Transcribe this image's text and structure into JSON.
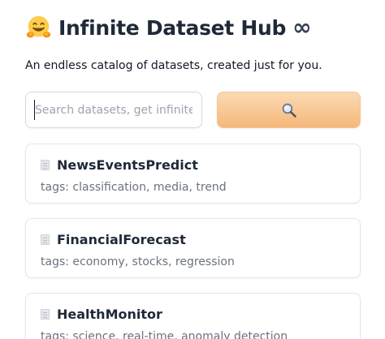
{
  "header": {
    "emoji_icon": "hugging-face-emoji",
    "title": "Infinite Dataset Hub",
    "infinity_symbol": "∞"
  },
  "subtitle": "An endless catalog of datasets, created just for you.",
  "search": {
    "placeholder": "Search datasets, get infinite results",
    "value": "",
    "button_icon": "magnifier-icon",
    "button_color": "#f6b87a"
  },
  "datasets": [
    {
      "icon": "document-icon",
      "name": "NewsEventsPredict",
      "tags": "tags: classification, media, trend"
    },
    {
      "icon": "document-icon",
      "name": "FinancialForecast",
      "tags": "tags: economy, stocks, regression"
    },
    {
      "icon": "document-icon",
      "name": "HealthMonitor",
      "tags": "tags: science, real-time, anomaly detection"
    }
  ]
}
